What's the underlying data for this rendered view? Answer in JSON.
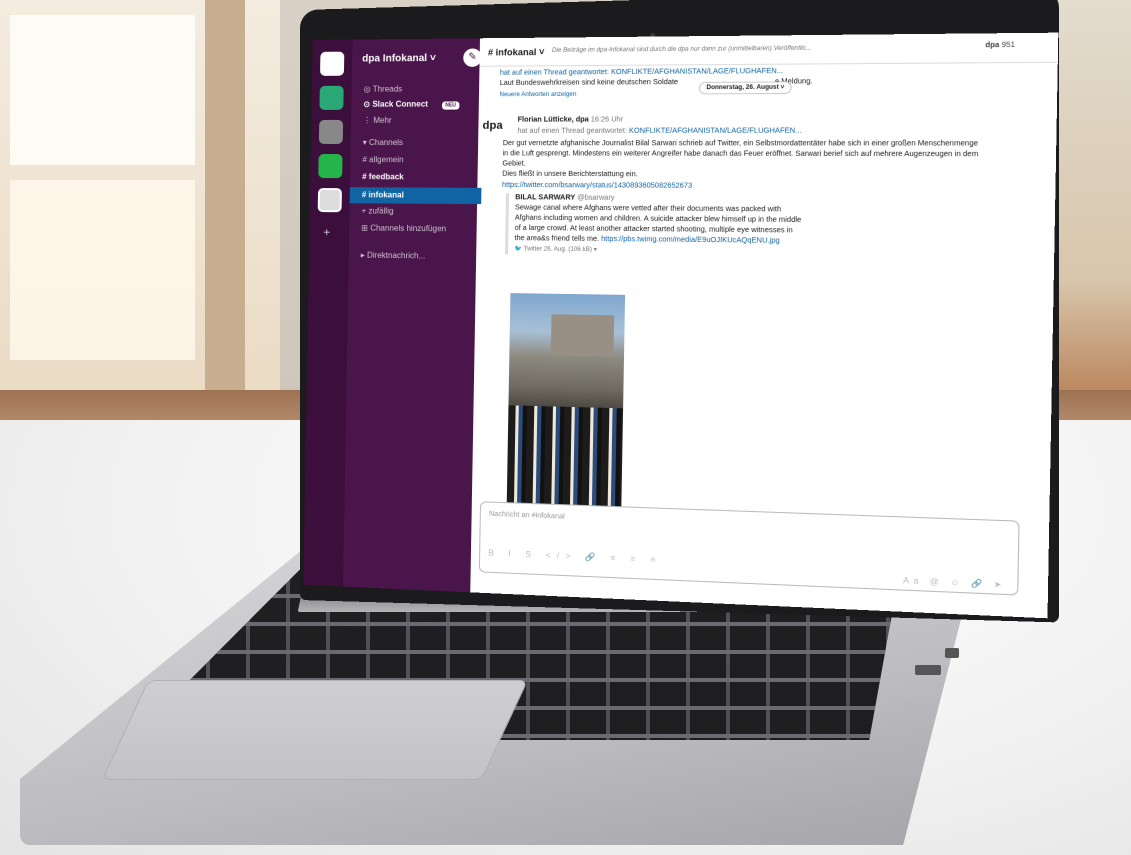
{
  "workspace": {
    "name": "dpa Infokanal",
    "dropdown": "˅"
  },
  "sidebar": {
    "items": [
      {
        "label": "Threads"
      },
      {
        "label": "Slack Connect",
        "badge": "NEU"
      },
      {
        "label": "Mehr"
      },
      {
        "label": "Channels"
      },
      {
        "label": "# allgemein"
      },
      {
        "label": "# feedback"
      },
      {
        "label": "# infokanal"
      },
      {
        "label": "+ zufällig"
      },
      {
        "label": "Channels hinzufügen"
      },
      {
        "label": "Direktnachrich..."
      }
    ]
  },
  "channel": {
    "title": "# infokanal",
    "description": "Die Beiträge im dpa-Infokanal sind durch die dpa nur dann zur (unmittelbaren) Veröffentlic...",
    "member_count": "951",
    "top_right_logo": "dpa"
  },
  "messages": {
    "prev_reply": "hat auf einen Thread geantwortet: KONFLIKTE/AFGHANISTAN/LAGE/FLUGHAFEN...",
    "prev_text": "Laut Bundeswehrkreisen sind keine deutschen Soldate",
    "prev_text_end": "e Meldung.",
    "newer_replies": "Neuere Antworten anzeigen",
    "date_pill": "Donnerstag, 26. August ˅",
    "author": "Florian Lütticke, dpa",
    "time": "16:26 Uhr",
    "reply_prefix": "hat auf einen Thread geantwortet:",
    "reply_link": "KONFLIKTE/AFGHANISTAN/LAGE/FLUGHAFEN...",
    "body_1": "Der gut vernetzte afghanische Journalist Bilal Sarwari schrieb auf Twitter, ein Selbstmordattentäter habe sich in einer großen Menschenmenge",
    "body_2": "in die Luft gesprengt. Mindestens ein weiterer Angreifer habe danach das Feuer eröffnet. Sarwari berief sich auf mehrere Augenzeugen in dem",
    "body_3": "Gebiet.",
    "body_4": "Dies fließt in unsere Berichterstattung ein.",
    "tweet_link": "https://twitter.com/bsarwary/status/1430893605082652673",
    "tweet_author": "BILAL SARWARY",
    "tweet_handle": "@bsarwary",
    "tweet_1": "Sewage canal where Afghans were vetted after their documents was packed with",
    "tweet_2": "Afghans including women and children. A suicide attacker blew himself up in the middle",
    "tweet_3": "of a large crowd. At least another attacker started shooting, multiple eye witnesses in",
    "tweet_4": "the area&s friend tells me.",
    "tweet_pic_link": "https://pbs.twimg.com/media/E9uOJIKUcAQqENU.jpg",
    "tweet_meta": "Twitter 26. Aug. (106 kB) ▾"
  },
  "composer": {
    "placeholder": "Nachricht an #infokanal",
    "tools": "B I S </> 🔗 ≡ ≡ ≡",
    "send": "Aa @ ☺ 🔗 ➤"
  }
}
